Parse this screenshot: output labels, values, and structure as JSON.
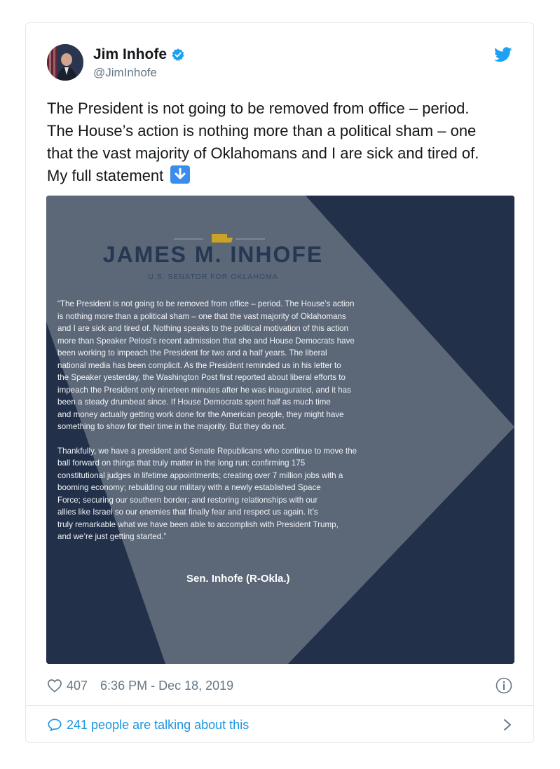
{
  "author": {
    "name": "Jim Inhofe",
    "handle": "@JimInhofe"
  },
  "tweet": {
    "lines": [
      "The President is not going to be removed from office – period.",
      "The House’s action is nothing more than a political sham – one",
      "that the vast majority of Oklahomans and I are sick and tired of.",
      "My full statement"
    ],
    "emoji": "down-arrow-emoji"
  },
  "statement": {
    "name": "JAMES M. INHOFE",
    "subtitle": "U.S. SENATOR FOR OKLAHOMA",
    "paragraph1": [
      "“The President is not going to be removed from office – period. The House’s action",
      "is nothing more than a political sham – one that the vast majority of Oklahomans",
      "and I are sick and tired of. Nothing speaks to the political motivation of this action",
      "more than Speaker Pelosi’s recent admission that she and House Democrats have",
      "been working to impeach the President for two and a half years. The liberal",
      "national media has been complicit. As the President reminded us in his letter to",
      "the Speaker yesterday, the Washington Post first reported about liberal efforts to",
      "impeach the President only nineteen minutes after he was inaugurated, and it has",
      "been a steady drumbeat since. If House Democrats spent half as much time",
      "and money actually getting work done for the American people, they might have",
      "something to show for their time in the majority. But they do not."
    ],
    "paragraph2": [
      "Thankfully, we have a president and Senate Republicans who continue to move the",
      "ball forward on things that truly matter in the long run: confirming 175",
      "constitutional judges in lifetime appointments; creating over 7 million jobs with a",
      "booming economy; rebuilding our military with a newly established Space",
      "Force; securing our southern border; and restoring relationships with our",
      "allies like Israel so our enemies that finally fear and respect us again. It’s",
      "truly remarkable what we have been able to accomplish with President Trump,",
      "and we’re just getting started.”"
    ],
    "signature": "Sen. Inhofe (R-Okla.)"
  },
  "meta": {
    "likes": "407",
    "timestamp": "6:36 PM - Dec 18, 2019"
  },
  "footer": {
    "talking": "241 people are talking about this"
  },
  "colors": {
    "twitter_blue": "#1da1f2",
    "link_blue": "#1b95e0",
    "media_dark": "#22304a",
    "media_light": "#5e6a7c",
    "oklahoma_gold": "#c9a227"
  }
}
